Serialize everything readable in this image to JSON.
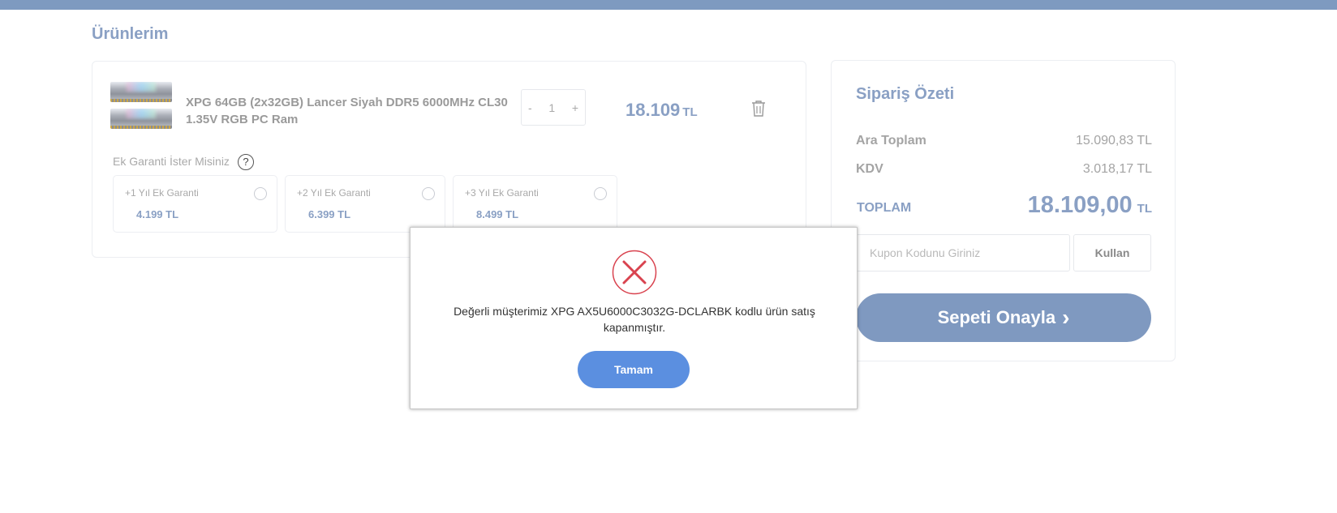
{
  "page": {
    "title": "Ürünlerim"
  },
  "product": {
    "name": "XPG 64GB (2x32GB) Lancer Siyah DDR5 6000MHz CL30 1.35V RGB PC Ram",
    "quantity": "1",
    "minus": "-",
    "plus": "+",
    "price": "18.109",
    "currency": "TL",
    "image_icon": "ram-module-image",
    "delete_icon": "trash-icon"
  },
  "warranty": {
    "title": "Ek Garanti İster Misiniz",
    "help": "?",
    "options": [
      {
        "label": "+1 Yıl Ek Garanti",
        "price": "4.199 TL"
      },
      {
        "label": "+2 Yıl Ek Garanti",
        "price": "6.399 TL"
      },
      {
        "label": "+3 Yıl Ek Garanti",
        "price": "8.499 TL"
      }
    ]
  },
  "summary": {
    "title": "Sipariş Özeti",
    "subtotal_label": "Ara Toplam",
    "subtotal_value": "15.090,83 TL",
    "tax_label": "KDV",
    "tax_value": "3.018,17 TL",
    "total_label": "TOPLAM",
    "total_value": "18.109,00",
    "total_currency": "TL",
    "coupon_placeholder": "Kupon Kodunu Giriniz",
    "coupon_button": "Kullan",
    "confirm_button": "Sepeti Onayla",
    "confirm_arrow": "›"
  },
  "modal": {
    "message": "Değerli müşterimiz XPG AX5U6000C3032G-DCLARBK kodlu ürün satış kapanmıştır.",
    "ok_button": "Tamam",
    "icon": "error-x-icon"
  },
  "colors": {
    "topbar": "#7e9ac0",
    "accent": "#8aa0c4",
    "confirm_button": "#7f99c0",
    "ok_button": "#5b8fe0",
    "error": "#d9434f"
  }
}
